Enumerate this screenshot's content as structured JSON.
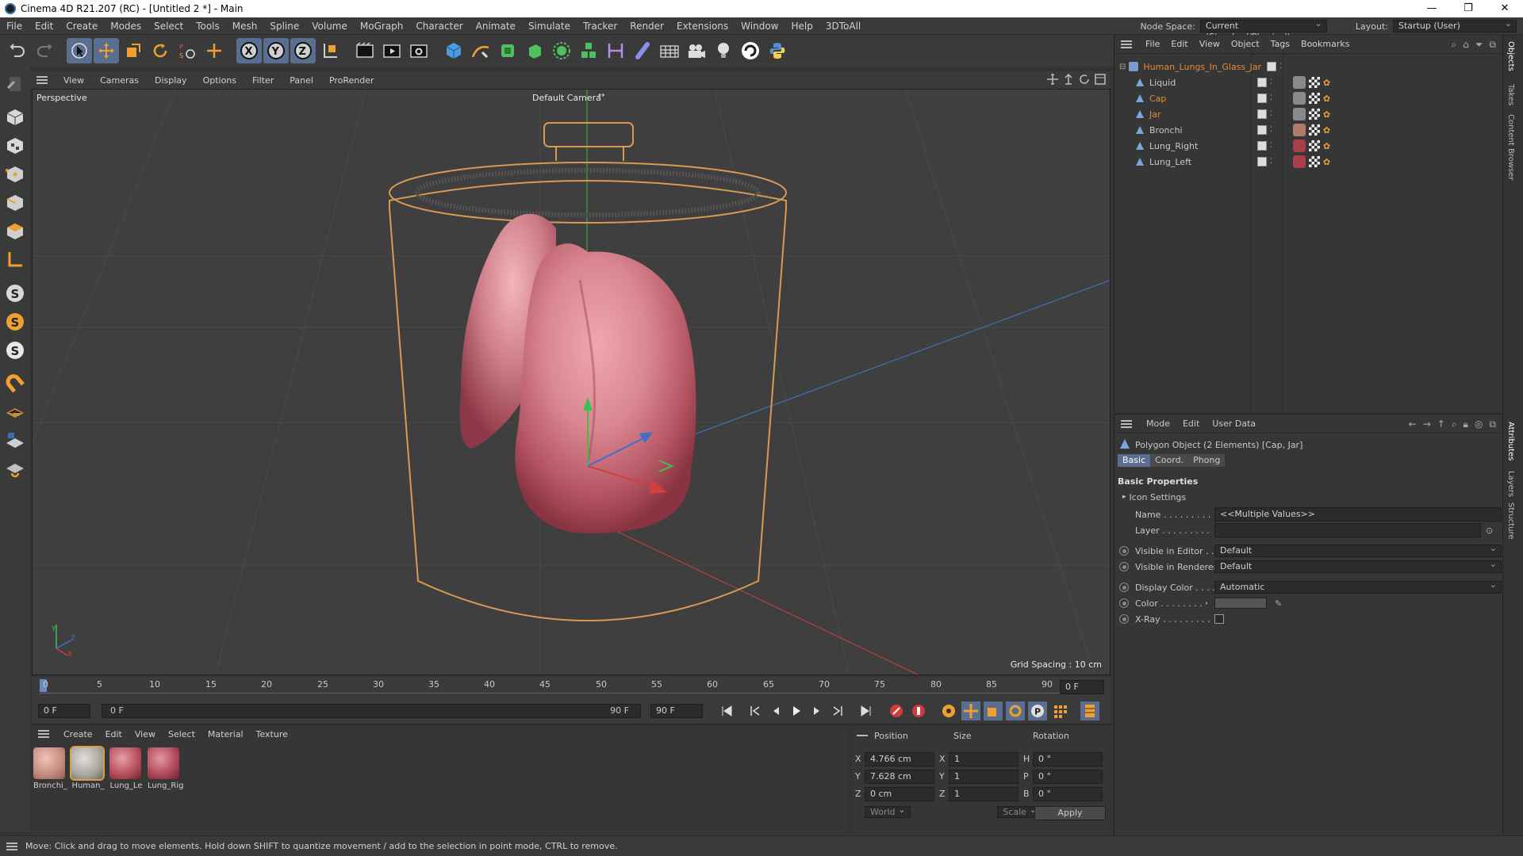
{
  "window": {
    "title": "Cinema 4D R21.207 (RC) - [Untitled 2 *] - Main",
    "controls": [
      "—",
      "❐",
      "✕"
    ]
  },
  "menubar": {
    "items": [
      "File",
      "Edit",
      "Create",
      "Modes",
      "Select",
      "Tools",
      "Mesh",
      "Spline",
      "Volume",
      "MoGraph",
      "Character",
      "Animate",
      "Simulate",
      "Tracker",
      "Render",
      "Extensions",
      "Window",
      "Help",
      "3DToAll"
    ],
    "node_space_label": "Node Space:",
    "node_space_value": "Current (Standard/Physical)",
    "layout_label": "Layout:",
    "layout_value": "Startup (User)"
  },
  "toolbar": {
    "tools": [
      "undo-icon",
      "redo-icon",
      "select-arrow-icon",
      "move-icon",
      "scale-icon",
      "rotate-icon",
      "psr-icon",
      "add-axis-icon",
      "x-axis-icon",
      "y-axis-icon",
      "z-axis-icon",
      "coordinate-system-icon",
      "render-view-icon",
      "render-picture-viewer-icon",
      "render-settings-icon",
      "cube-primitive-icon",
      "pen-spline-icon",
      "subdivision-icon",
      "extrude-icon",
      "cloner-icon",
      "mograph-icon",
      "bend-deformer-icon",
      "sculpt-icon",
      "floor-icon",
      "camera-icon",
      "light-icon",
      "3dtoall-icon",
      "python-icon"
    ],
    "axis_labels": [
      "X",
      "Y",
      "Z"
    ]
  },
  "viewport": {
    "menu": [
      "View",
      "Cameras",
      "Display",
      "Options",
      "Filter",
      "Panel",
      "ProRender"
    ],
    "view_name": "Perspective",
    "camera_name": "Default Camera",
    "grid_spacing": "Grid Spacing : 10 cm",
    "axis_indicator": [
      "Y",
      "Z",
      "X"
    ]
  },
  "timeline": {
    "ticks": [
      "0",
      "5",
      "10",
      "15",
      "20",
      "25",
      "30",
      "35",
      "40",
      "45",
      "50",
      "55",
      "60",
      "65",
      "70",
      "75",
      "80",
      "85",
      "90"
    ],
    "current_frame_display": "0 F"
  },
  "transport": {
    "start_frame": "0 F",
    "range_start": "0 F",
    "range_end": "90 F",
    "end_frame": "90 F",
    "buttons": [
      "go-start-icon",
      "prev-key-icon",
      "prev-frame-icon",
      "play-icon",
      "next-frame-icon",
      "next-key-icon",
      "go-end-icon",
      "record-icon",
      "autokey-icon",
      "keyframe-selection-icon",
      "pos-key-icon",
      "scale-key-icon",
      "rot-key-icon",
      "param-key-icon",
      "pla-key-icon",
      "timeline-window-icon"
    ]
  },
  "material_manager": {
    "menu": [
      "Create",
      "Edit",
      "View",
      "Select",
      "Material",
      "Texture"
    ],
    "materials": [
      {
        "label": "Bronchi_",
        "color": "#d8a79b"
      },
      {
        "label": "Human_",
        "color": "#b9b6ae"
      },
      {
        "label": "Lung_Le",
        "color": "#b8505c"
      },
      {
        "label": "Lung_Rig",
        "color": "#b44a58"
      }
    ]
  },
  "coordinates": {
    "headers": [
      "Position",
      "Size",
      "Rotation"
    ],
    "rows": [
      {
        "axis": "X",
        "pos": "4.766 cm",
        "size_axis": "X",
        "size": "1",
        "rot_axis": "H",
        "rot": "0 °"
      },
      {
        "axis": "Y",
        "pos": "7.628 cm",
        "size_axis": "Y",
        "size": "1",
        "rot_axis": "P",
        "rot": "0 °"
      },
      {
        "axis": "Z",
        "pos": "0 cm",
        "size_axis": "Z",
        "size": "1",
        "rot_axis": "B",
        "rot": "0 °"
      }
    ],
    "space_mode": "World",
    "size_mode": "Scale",
    "apply_label": "Apply"
  },
  "object_manager": {
    "menu": [
      "File",
      "Edit",
      "View",
      "Object",
      "Tags",
      "Bookmarks"
    ],
    "objects": [
      {
        "name": "Human_Lungs_In_Glass_Jar",
        "indent": 0,
        "color": "#e08a3c",
        "tags": 0
      },
      {
        "name": "Liquid",
        "indent": 1,
        "color": "#cfcfcf",
        "tags": 3,
        "tag_color": "#8a8a8a"
      },
      {
        "name": "Cap",
        "indent": 1,
        "color": "#e08a3c",
        "tags": 3,
        "tag_color": "#8a8a8a"
      },
      {
        "name": "Jar",
        "indent": 1,
        "color": "#e08a3c",
        "tags": 3,
        "tag_color": "#8a8a8a"
      },
      {
        "name": "Bronchi",
        "indent": 1,
        "color": "#cfcfcf",
        "tags": 3,
        "tag_color": "#b07a6a"
      },
      {
        "name": "Lung_Right",
        "indent": 1,
        "color": "#cfcfcf",
        "tags": 3,
        "tag_color": "#a8404c"
      },
      {
        "name": "Lung_Left",
        "indent": 1,
        "color": "#cfcfcf",
        "tags": 3,
        "tag_color": "#a8404c"
      }
    ]
  },
  "attribute_manager": {
    "menu": [
      "Mode",
      "Edit",
      "User Data"
    ],
    "object_title": "Polygon Object (2 Elements) [Cap, Jar]",
    "tabs": [
      "Basic",
      "Coord.",
      "Phong"
    ],
    "active_tab": "Basic",
    "section": "Basic Properties",
    "icon_settings": "Icon Settings",
    "name_label": "Name . . . . . . . . .",
    "name_value": "<<Multiple Values>>",
    "layer_label": "Layer . . . . . . . . .",
    "layer_value": "",
    "visible_editor_label": "Visible in Editor . .",
    "visible_editor_value": "Default",
    "visible_renderer_label": "Visible in Renderer",
    "visible_renderer_value": "Default",
    "display_color_label": "Display Color . . . .",
    "display_color_value": "Automatic",
    "color_label": "Color . . . . . . . .",
    "xray_label": "X-Ray . . . . . . . . ."
  },
  "right_tabs": [
    "Objects",
    "Takes",
    "Content Browser",
    "Attributes",
    "Layers",
    "Structure"
  ],
  "status": {
    "text": "Move: Click and drag to move elements. Hold down SHIFT to quantize movement / add to the selection in point mode, CTRL to remove."
  },
  "colors": {
    "accent_selection": "#5a6f90",
    "highlight_orange": "#e08a3c",
    "viewport_bg": "#3f3f3f",
    "panel_bg": "#363636"
  }
}
